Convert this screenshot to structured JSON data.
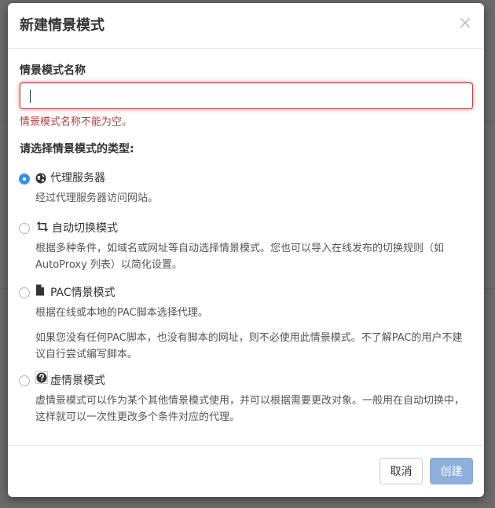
{
  "modal": {
    "title": "新建情景模式",
    "close_glyph": "×"
  },
  "form": {
    "name_label": "情景模式名称",
    "name_value": "",
    "name_error": "情景模式名称不能为空。",
    "type_label": "请选择情景模式的类型:"
  },
  "options": [
    {
      "title": "代理服务器",
      "icon": "globe-icon",
      "checked": true,
      "desc": [
        "经过代理服务器访问网站。"
      ]
    },
    {
      "title": "自动切换模式",
      "icon": "retweet-icon",
      "checked": false,
      "desc": [
        "根据多种条件，如域名或网址等自动选择情景模式。您也可以导入在线发布的切换规则（如 AutoProxy 列表）以简化设置。"
      ]
    },
    {
      "title": "PAC情景模式",
      "icon": "file-icon",
      "checked": false,
      "desc": [
        "根据在线或本地的PAC脚本选择代理。",
        "如果您没有任何PAC脚本，也没有脚本的网址，则不必使用此情景模式。不了解PAC的用户不建议自行尝试编写脚本。"
      ]
    },
    {
      "title": "虚情景模式",
      "icon": "question-sign-icon",
      "checked": false,
      "desc": [
        "虚情景模式可以作为某个其他情景模式使用，并可以根据需要更改对象。一般用在自动切换中，这样就可以一次性更改多个条件对应的代理。"
      ]
    }
  ],
  "footer": {
    "cancel_label": "取消",
    "create_label": "创建"
  },
  "colors": {
    "error": "#a94442",
    "radio_checked": "#3a8fe6",
    "primary_disabled": "#8db1da"
  }
}
